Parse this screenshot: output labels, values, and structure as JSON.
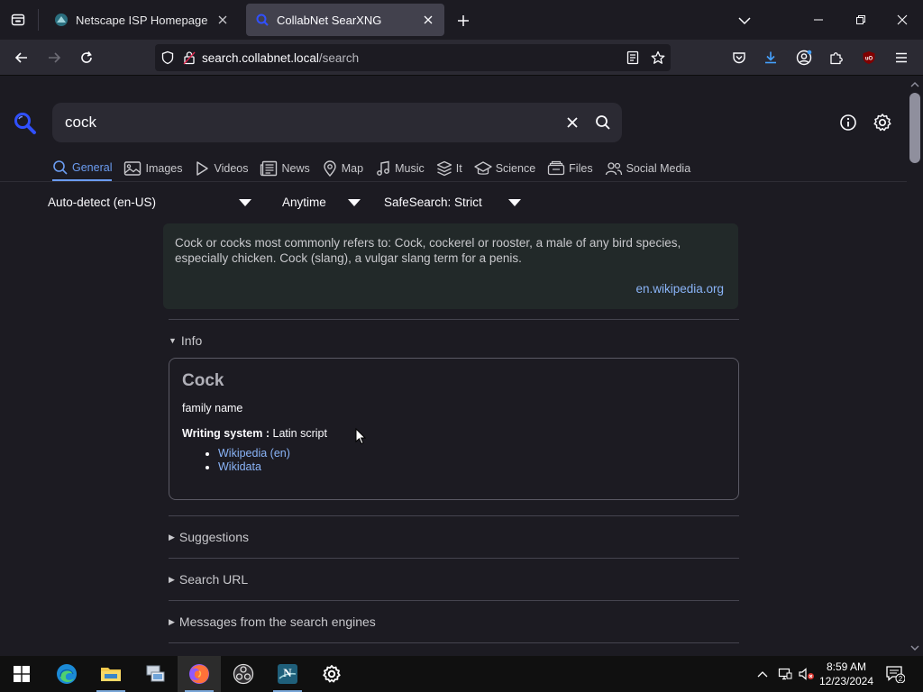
{
  "browser": {
    "tabs": [
      {
        "label": "Netscape ISP Homepage",
        "active": false
      },
      {
        "label": "CollabNet SearXNG",
        "active": true
      }
    ],
    "url": {
      "host": "search.collabnet.local",
      "path": "/search"
    }
  },
  "search": {
    "query": "cock",
    "categories": [
      {
        "label": "General",
        "icon": "search-icon",
        "active": true
      },
      {
        "label": "Images",
        "icon": "image-icon"
      },
      {
        "label": "Videos",
        "icon": "play-icon"
      },
      {
        "label": "News",
        "icon": "newspaper-icon"
      },
      {
        "label": "Map",
        "icon": "map-pin-icon"
      },
      {
        "label": "Music",
        "icon": "music-icon"
      },
      {
        "label": "It",
        "icon": "layers-icon"
      },
      {
        "label": "Science",
        "icon": "school-icon"
      },
      {
        "label": "Files",
        "icon": "files-icon"
      },
      {
        "label": "Social Media",
        "icon": "people-icon"
      }
    ],
    "filters": {
      "language": "Auto-detect (en-US)",
      "time": "Anytime",
      "safesearch": "SafeSearch: Strict"
    }
  },
  "answer": {
    "text": "Cock or cocks most commonly refers to: Cock, cockerel or rooster, a male of any bird species, especially chicken. Cock (slang), a vulgar slang term for a penis.",
    "source": "en.wikipedia.org"
  },
  "sidebar": {
    "info_label": "Info",
    "infobox": {
      "title": "Cock",
      "description": "family name",
      "attribute_label": "Writing system :",
      "attribute_value": "Latin script",
      "links": [
        "Wikipedia (en)",
        "Wikidata"
      ]
    },
    "sections": [
      "Suggestions",
      "Search URL",
      "Messages from the search engines"
    ]
  },
  "taskbar": {
    "time": "8:59 AM",
    "date": "12/23/2024",
    "notifications": "2"
  },
  "colors": {
    "accent": "#6b9cf1",
    "link": "#8ab4f8",
    "page_bg": "#1c1b22",
    "answer_bg": "#222929"
  }
}
